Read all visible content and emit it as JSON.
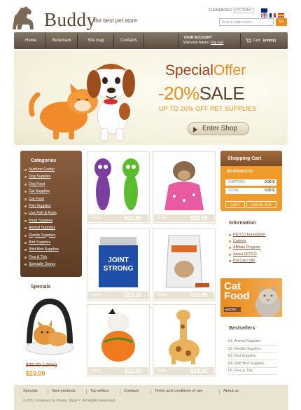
{
  "header": {
    "logo": "Buddy",
    "tagline": "the best pet store",
    "currencies_label": "CURRENCIES :",
    "currency_value": "US Dollar",
    "search_placeholder": "Search entire store...",
    "search_button": "Go"
  },
  "nav": {
    "items": [
      "Home",
      "Bookmark",
      "Site map",
      "Contacts"
    ],
    "account_label": "YOUR ACCOUNT",
    "welcome": "Welcome Adam",
    "logout": "(log out)",
    "cart_label": "Cart",
    "cart_status": "(empty)"
  },
  "banner": {
    "special": "Special",
    "offer": "Offer",
    "percent": "-20%",
    "sale": "SALE",
    "subtitle": "UP TO 20% OFF PET SUPPLIES",
    "button": "Enter Shop"
  },
  "categories": {
    "title": "Categories",
    "items": [
      "Nutrition Center",
      "Dog Supplies",
      "Dog Food",
      "Cat Supplies",
      "Cat Food",
      "Fish Supplies",
      "Live Fish & Rock",
      "Pond Supplies",
      "Animal Supplies",
      "Reptile Supplies",
      "Bird Supplies",
      "Wild Bird Supplies",
      "Flea & Tick",
      "Specialty Stores"
    ]
  },
  "specials": {
    "title": "Specials",
    "old_price": "$35.00",
    "discount": "(-20%)",
    "new_price": "$23.00"
  },
  "products": [
    {
      "details": "details",
      "price": "$11.85",
      "image": "plush-toys"
    },
    {
      "details": "details",
      "price": "$24.50",
      "image": "dog-dress"
    },
    {
      "details": "details",
      "price": "$22.30",
      "image": "joint-strong-jar",
      "label": "JOINT STRONG"
    },
    {
      "details": "details",
      "price": "$15.85",
      "image": "treat-bag"
    },
    {
      "details": "details",
      "price": "$12.20",
      "image": "dog-costume"
    },
    {
      "details": "details",
      "price": "$13.00",
      "image": "giraffe-toy"
    }
  ],
  "cart": {
    "title": "Shopping Cart",
    "no_products": "NO PRODUCTS",
    "shipping_label": "SHIPPING",
    "shipping_value": "0.00 $",
    "total_label": "TOTAL",
    "total_value": "0.00 $",
    "cart_button": "CART",
    "checkout_button": "CHECK OUT"
  },
  "information": {
    "title": "Information",
    "items": [
      "PETCO Foundation",
      "Careers",
      "Affiliate Program",
      "About PETCO",
      "Pet Care Info"
    ]
  },
  "promo": {
    "line1": "Cat",
    "line2": "Food",
    "more": "MORE"
  },
  "bestsellers": {
    "title": "Bestsellers",
    "items": [
      "01. Animal Supplies",
      "02. Reptile Supplies",
      "03. Bird Supplies",
      "04. Wild Bird Supplies",
      "05. Flea & Tick"
    ]
  },
  "footer": {
    "links": [
      "Specials",
      "New products",
      "Top sellers",
      "Contacts",
      "Terms and conditions of use",
      "About us"
    ],
    "copyright": "© 2011 Powered by Presta Shop™. All Rights Reserved"
  },
  "colors": {
    "accent": "#e98b1d",
    "brown": "#5c4331",
    "panel": "#7e4e29"
  }
}
